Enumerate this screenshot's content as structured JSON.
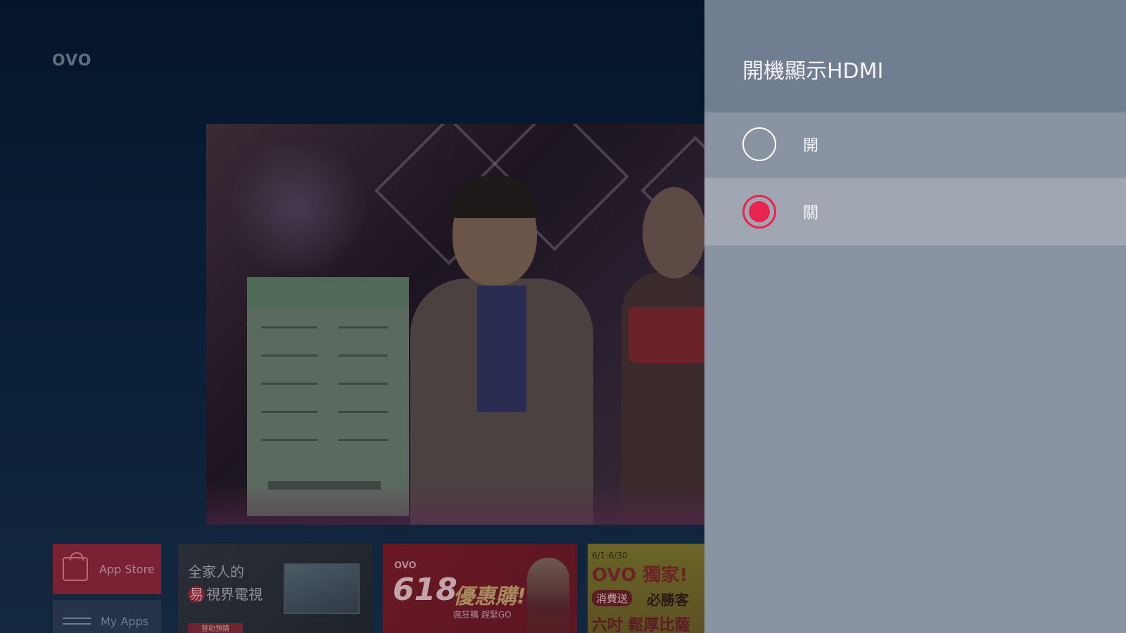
{
  "launcher": {
    "logo": "OVO",
    "tiles": {
      "app_store": "App Store",
      "my_apps": "My Apps",
      "promo1": {
        "line1": "全家人的",
        "line2_badge": "易",
        "line2": "視界電視",
        "cta": "替助預購"
      },
      "promo2": {
        "brand": "OVO",
        "big": "618",
        "sale": "優惠購!",
        "sub": "瘋狂購 趕緊GO"
      },
      "promo3": {
        "dates": "6/1-6/30",
        "headline": "OVO 獨家!",
        "pill": "消費送",
        "win": "必勝客",
        "bottom": "六吋 鬆厚比薩"
      }
    }
  },
  "panel": {
    "title": "開機顯示HDMI",
    "options": [
      {
        "label": "開",
        "selected": false,
        "focused": false
      },
      {
        "label": "關",
        "selected": true,
        "focused": true
      }
    ]
  },
  "colors": {
    "accent": "#e8254d",
    "panel_bg": "#8a93a2",
    "panel_header": "#717d90",
    "focused_row": "#a0a7b3"
  }
}
